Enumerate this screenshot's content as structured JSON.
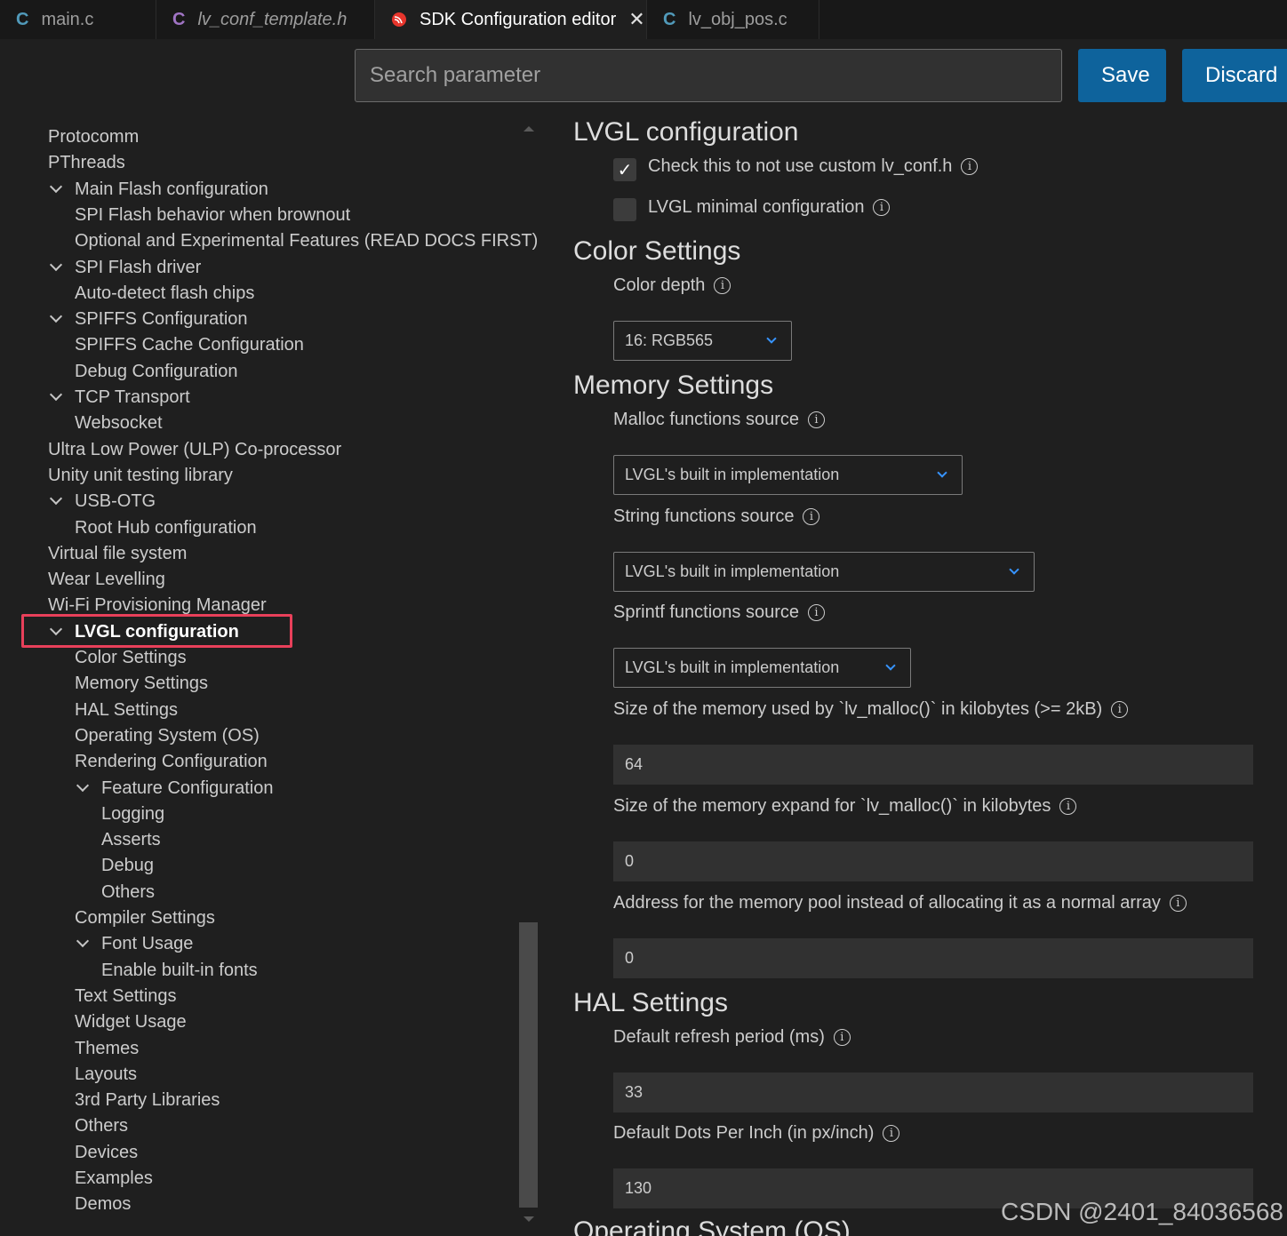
{
  "tabs": [
    {
      "label": "main.c",
      "icon": "c-file-icon"
    },
    {
      "label": "lv_conf_template.h",
      "icon": "c-header-icon"
    },
    {
      "label": "SDK Configuration editor",
      "icon": "espressif-icon",
      "active": true
    },
    {
      "label": "lv_obj_pos.c",
      "icon": "c-file-icon"
    }
  ],
  "toolbar": {
    "search_placeholder": "Search parameter",
    "save_label": "Save",
    "discard_label": "Discard",
    "accent_color": "#0e639c"
  },
  "tree": [
    {
      "label": "Protocomm",
      "level": 0
    },
    {
      "label": "PThreads",
      "level": 0
    },
    {
      "label": "Main Flash configuration",
      "level": 1,
      "expanded": true
    },
    {
      "label": "SPI Flash behavior when brownout",
      "level": 1
    },
    {
      "label": "Optional and Experimental Features (READ DOCS FIRST)",
      "level": 1
    },
    {
      "label": "SPI Flash driver",
      "level": 1,
      "expanded": true
    },
    {
      "label": "Auto-detect flash chips",
      "level": 1
    },
    {
      "label": "SPIFFS Configuration",
      "level": 1,
      "expanded": true
    },
    {
      "label": "SPIFFS Cache Configuration",
      "level": 1
    },
    {
      "label": "Debug Configuration",
      "level": 1
    },
    {
      "label": "TCP Transport",
      "level": 1,
      "expanded": true
    },
    {
      "label": "Websocket",
      "level": 1
    },
    {
      "label": "Ultra Low Power (ULP) Co-processor",
      "level": 0
    },
    {
      "label": "Unity unit testing library",
      "level": 0
    },
    {
      "label": "USB-OTG",
      "level": 1,
      "expanded": true
    },
    {
      "label": "Root Hub configuration",
      "level": 1
    },
    {
      "label": "Virtual file system",
      "level": 0
    },
    {
      "label": "Wear Levelling",
      "level": 0
    },
    {
      "label": "Wi-Fi Provisioning Manager",
      "level": 0
    },
    {
      "label": "LVGL configuration",
      "level": 1,
      "expanded": true,
      "selected": true
    },
    {
      "label": "Color Settings",
      "level": 1
    },
    {
      "label": "Memory Settings",
      "level": 1
    },
    {
      "label": "HAL Settings",
      "level": 1
    },
    {
      "label": "Operating System (OS)",
      "level": 1
    },
    {
      "label": "Rendering Configuration",
      "level": 1
    },
    {
      "label": "Feature Configuration",
      "level": 2,
      "expanded": true
    },
    {
      "label": "Logging",
      "level": 2
    },
    {
      "label": "Asserts",
      "level": 2
    },
    {
      "label": "Debug",
      "level": 2
    },
    {
      "label": "Others",
      "level": 2
    },
    {
      "label": "Compiler Settings",
      "level": 1
    },
    {
      "label": "Font Usage",
      "level": 2,
      "expanded": true
    },
    {
      "label": "Enable built-in fonts",
      "level": 2
    },
    {
      "label": "Text Settings",
      "level": 1
    },
    {
      "label": "Widget Usage",
      "level": 1
    },
    {
      "label": "Themes",
      "level": 1
    },
    {
      "label": "Layouts",
      "level": 1
    },
    {
      "label": "3rd Party Libraries",
      "level": 1
    },
    {
      "label": "Others",
      "level": 1
    },
    {
      "label": "Devices",
      "level": 1
    },
    {
      "label": "Examples",
      "level": 1
    },
    {
      "label": "Demos",
      "level": 1
    }
  ],
  "highlight_color": "#e8405a",
  "content": {
    "lvgl_title": "LVGL configuration",
    "check_custom_label": "Check this to not use custom lv_conf.h",
    "check_custom_checked": true,
    "check_minimal_label": "LVGL minimal configuration",
    "check_minimal_checked": false,
    "color_title": "Color Settings",
    "color_depth_label": "Color depth",
    "color_depth_value": "16: RGB565",
    "memory_title": "Memory Settings",
    "malloc_label": "Malloc functions source",
    "malloc_value": "LVGL's built in implementation",
    "string_label": "String functions source",
    "string_value": "LVGL's built in implementation",
    "sprintf_label": "Sprintf functions source",
    "sprintf_value": "LVGL's built in implementation",
    "mem_size_label": "Size of the memory used by `lv_malloc()` in kilobytes (>= 2kB)",
    "mem_size_value": "64",
    "mem_expand_label": "Size of the memory expand for `lv_malloc()` in kilobytes",
    "mem_expand_value": "0",
    "mem_addr_label": "Address for the memory pool instead of allocating it as a normal array",
    "mem_addr_value": "0",
    "hal_title": "HAL Settings",
    "refresh_label": "Default refresh period (ms)",
    "refresh_value": "33",
    "dpi_label": "Default Dots Per Inch (in px/inch)",
    "dpi_value": "130",
    "os_title_partial": "Operating System (OS)"
  },
  "watermark": "CSDN @2401_84036568"
}
